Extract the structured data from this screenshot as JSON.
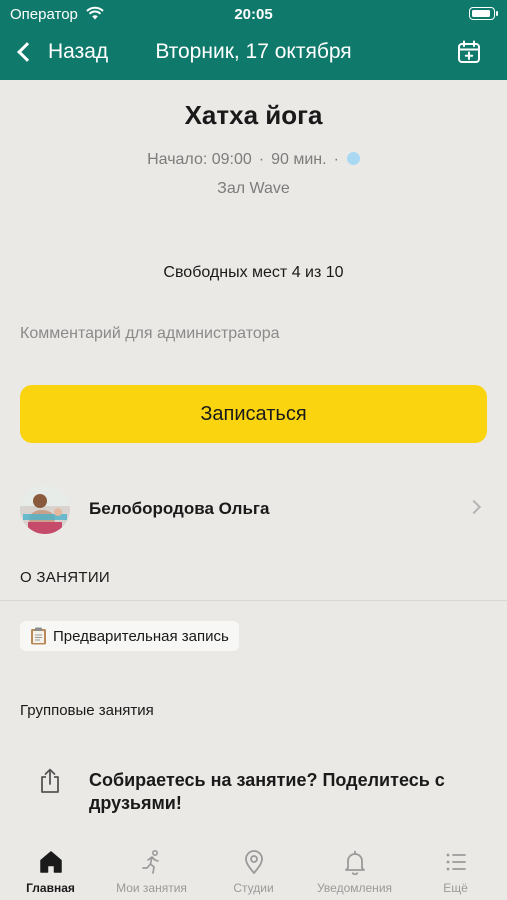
{
  "status_bar": {
    "carrier": "Оператор",
    "time": "20:05",
    "battery_level": 0.95
  },
  "nav": {
    "back_label": "Назад",
    "title": "Вторник, 17 октября",
    "calendar_icon": "calendar-add-icon"
  },
  "class": {
    "title": "Хатха йога",
    "start": "Начало: 09:00",
    "duration": "90 мин.",
    "hall": "Зал Wave",
    "free_spots": "Свободных мест 4 из 10"
  },
  "comment_placeholder": "Комментарий для администратора",
  "signup_label": "Записаться",
  "trainer": {
    "name": "Белобородова Ольга"
  },
  "about": {
    "section_title": "О ЗАНЯТИИ",
    "tag": "Предварительная запись",
    "category": "Групповые занятия"
  },
  "share_text": "Собираетесь на занятие? Поделитесь с друзьями!",
  "colors": {
    "header": "#0f7a6b",
    "accent_button": "#f9d40f",
    "background": "#ebe9e6"
  },
  "tabs": [
    {
      "label": "Главная",
      "icon": "home-icon",
      "active": true
    },
    {
      "label": "Мои занятия",
      "icon": "runner-icon",
      "active": false
    },
    {
      "label": "Студии",
      "icon": "location-pin-icon",
      "active": false
    },
    {
      "label": "Уведомления",
      "icon": "bell-icon",
      "active": false
    },
    {
      "label": "Ещё",
      "icon": "list-icon",
      "active": false
    }
  ]
}
